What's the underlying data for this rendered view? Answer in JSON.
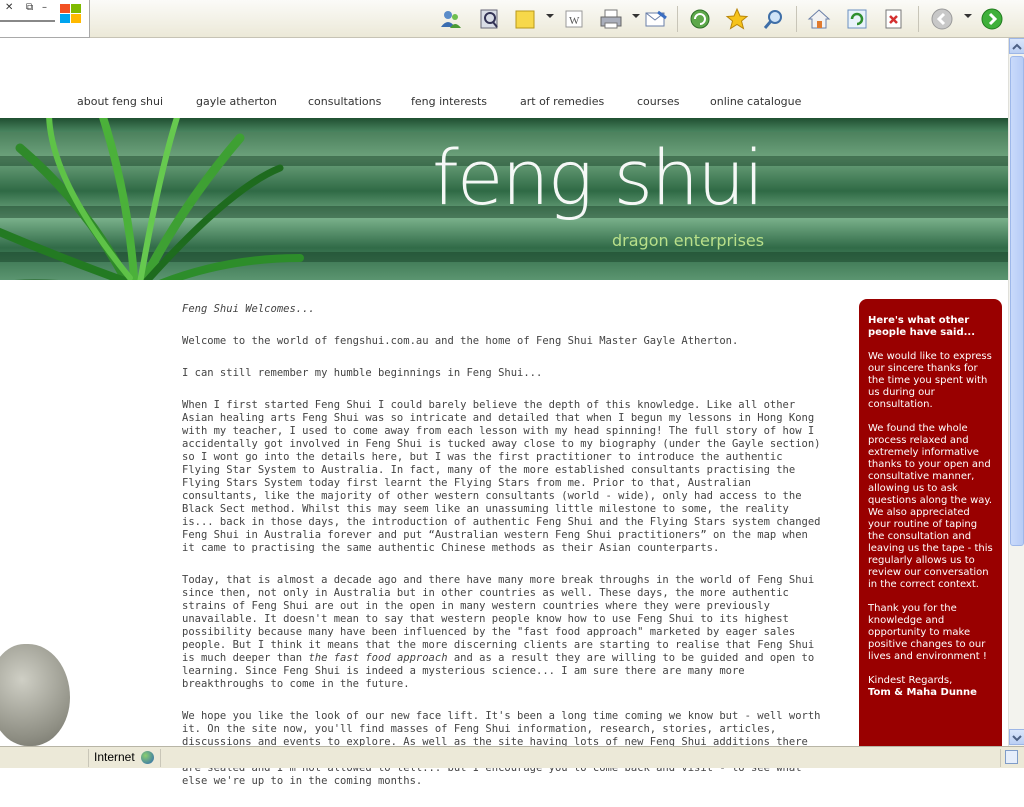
{
  "browser": {
    "window_controls": [
      "–",
      "⧉",
      "▭"
    ],
    "status_zone": "Internet",
    "toolbar_icons": [
      "contacts-icon",
      "research-icon",
      "note-icon",
      "word-icon",
      "print-icon",
      "mail-icon",
      "refresh-history-icon",
      "favorites-star-icon",
      "search-icon",
      "home-icon",
      "refresh-icon",
      "stop-icon",
      "back-icon",
      "forward-icon"
    ]
  },
  "nav": {
    "items": [
      "about feng shui",
      "gayle atherton",
      "consultations",
      "feng interests",
      "art of remedies",
      "courses",
      "online catalogue"
    ]
  },
  "banner": {
    "title": "feng shui",
    "subtitle": "dragon enterprises"
  },
  "content": {
    "heading": "Feng Shui Welcomes...",
    "p1": "Welcome to the world of fengshui.com.au and the home of Feng Shui Master Gayle Atherton.",
    "p2": "I can still remember my humble beginnings in Feng Shui...",
    "p3": "When I first started Feng Shui I could barely believe the depth of this knowledge. Like all other Asian healing arts Feng Shui was so intricate and detailed that when I begun my lessons in Hong Kong with my teacher, I used to come away from each lesson with my head spinning! The full story of how I accidentally got involved in Feng Shui is tucked away close to my biography (under the Gayle section) so I wont go into the details here, but I was the first practitioner to introduce the authentic Flying Star System to Australia. In fact, many of the more established consultants practising the Flying Stars System today first learnt the Flying Stars from me. Prior to that, Australian consultants, like the majority of other western consultants (world - wide), only had access to the Black Sect method. Whilst this may seem like an unassuming little milestone to some, the reality is... back in those days, the introduction of authentic Feng Shui and the Flying Stars system changed Feng Shui in Australia forever and put “Australian western Feng Shui practitioners” on the map when it came to practising the same authentic Chinese methods as their Asian counterparts.",
    "p4a": "Today, that is almost a decade ago and there have many more break throughs in the world of Feng Shui since then, not only in Australia but in other countries as well. These days, the more authentic strains of Feng Shui are out in the open in many western countries where they were previously unavailable. It doesn't mean to say that western people know how to use Feng Shui to its highest possibility because many have been influenced by the \"fast food approach\" marketed by eager sales people. But I think it means that the more discerning clients are starting to realise that Feng Shui is much deeper than ",
    "p4b": "the fast food approach",
    "p4c": " and as a result they are willing to be guided and open to learning. Since Feng Shui is indeed a mysterious science... I am sure there are many more breakthroughs to come in the future.",
    "p5": "We hope you like the look of our new face lift. It's been a long time coming we know but - well worth it. On the site now, you'll find masses of Feng Shui information, research, stories, articles, discussions and events to explore. As well as the site having lots of new Feng Shui additions there are many more Feng Shui surprises and innovations planned for the future... For the moment my lips are sealed and I'm not allowed to tell... but I encourage you to come back and visit - to see what else we're up to in the coming months."
  },
  "sidebar": {
    "title": "Here's what other people have said...",
    "t1": "We would like to express our sincere thanks for the time you spent with us during our consultation.",
    "t2": "We found the whole process relaxed and extremely informative thanks to your open and consultative manner, allowing us to ask questions along the way. We also appreciated your routine of taping the consultation and leaving us the tape - this regularly allows us to review our conversation in the correct context.",
    "t3": "Thank you for the knowledge and opportunity to make positive changes to our lives and environment !",
    "signoff": "Kindest Regards,",
    "name": "Tom & Maha Dunne"
  }
}
